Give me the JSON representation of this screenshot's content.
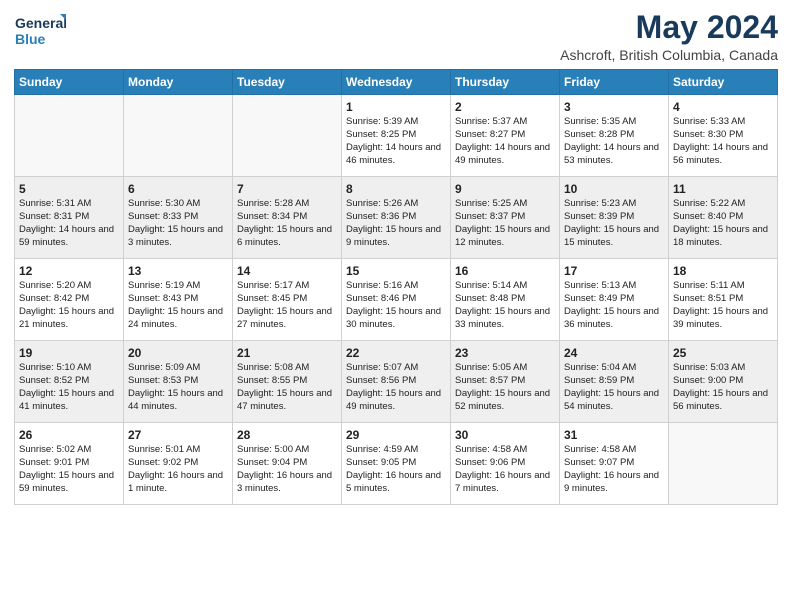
{
  "brand": {
    "name_line1": "General",
    "name_line2": "Blue"
  },
  "title": "May 2024",
  "location": "Ashcroft, British Columbia, Canada",
  "headers": [
    "Sunday",
    "Monday",
    "Tuesday",
    "Wednesday",
    "Thursday",
    "Friday",
    "Saturday"
  ],
  "weeks": [
    [
      {
        "day": "",
        "sunrise": "",
        "sunset": "",
        "daylight": ""
      },
      {
        "day": "",
        "sunrise": "",
        "sunset": "",
        "daylight": ""
      },
      {
        "day": "",
        "sunrise": "",
        "sunset": "",
        "daylight": ""
      },
      {
        "day": "1",
        "sunrise": "Sunrise: 5:39 AM",
        "sunset": "Sunset: 8:25 PM",
        "daylight": "Daylight: 14 hours and 46 minutes."
      },
      {
        "day": "2",
        "sunrise": "Sunrise: 5:37 AM",
        "sunset": "Sunset: 8:27 PM",
        "daylight": "Daylight: 14 hours and 49 minutes."
      },
      {
        "day": "3",
        "sunrise": "Sunrise: 5:35 AM",
        "sunset": "Sunset: 8:28 PM",
        "daylight": "Daylight: 14 hours and 53 minutes."
      },
      {
        "day": "4",
        "sunrise": "Sunrise: 5:33 AM",
        "sunset": "Sunset: 8:30 PM",
        "daylight": "Daylight: 14 hours and 56 minutes."
      }
    ],
    [
      {
        "day": "5",
        "sunrise": "Sunrise: 5:31 AM",
        "sunset": "Sunset: 8:31 PM",
        "daylight": "Daylight: 14 hours and 59 minutes."
      },
      {
        "day": "6",
        "sunrise": "Sunrise: 5:30 AM",
        "sunset": "Sunset: 8:33 PM",
        "daylight": "Daylight: 15 hours and 3 minutes."
      },
      {
        "day": "7",
        "sunrise": "Sunrise: 5:28 AM",
        "sunset": "Sunset: 8:34 PM",
        "daylight": "Daylight: 15 hours and 6 minutes."
      },
      {
        "day": "8",
        "sunrise": "Sunrise: 5:26 AM",
        "sunset": "Sunset: 8:36 PM",
        "daylight": "Daylight: 15 hours and 9 minutes."
      },
      {
        "day": "9",
        "sunrise": "Sunrise: 5:25 AM",
        "sunset": "Sunset: 8:37 PM",
        "daylight": "Daylight: 15 hours and 12 minutes."
      },
      {
        "day": "10",
        "sunrise": "Sunrise: 5:23 AM",
        "sunset": "Sunset: 8:39 PM",
        "daylight": "Daylight: 15 hours and 15 minutes."
      },
      {
        "day": "11",
        "sunrise": "Sunrise: 5:22 AM",
        "sunset": "Sunset: 8:40 PM",
        "daylight": "Daylight: 15 hours and 18 minutes."
      }
    ],
    [
      {
        "day": "12",
        "sunrise": "Sunrise: 5:20 AM",
        "sunset": "Sunset: 8:42 PM",
        "daylight": "Daylight: 15 hours and 21 minutes."
      },
      {
        "day": "13",
        "sunrise": "Sunrise: 5:19 AM",
        "sunset": "Sunset: 8:43 PM",
        "daylight": "Daylight: 15 hours and 24 minutes."
      },
      {
        "day": "14",
        "sunrise": "Sunrise: 5:17 AM",
        "sunset": "Sunset: 8:45 PM",
        "daylight": "Daylight: 15 hours and 27 minutes."
      },
      {
        "day": "15",
        "sunrise": "Sunrise: 5:16 AM",
        "sunset": "Sunset: 8:46 PM",
        "daylight": "Daylight: 15 hours and 30 minutes."
      },
      {
        "day": "16",
        "sunrise": "Sunrise: 5:14 AM",
        "sunset": "Sunset: 8:48 PM",
        "daylight": "Daylight: 15 hours and 33 minutes."
      },
      {
        "day": "17",
        "sunrise": "Sunrise: 5:13 AM",
        "sunset": "Sunset: 8:49 PM",
        "daylight": "Daylight: 15 hours and 36 minutes."
      },
      {
        "day": "18",
        "sunrise": "Sunrise: 5:11 AM",
        "sunset": "Sunset: 8:51 PM",
        "daylight": "Daylight: 15 hours and 39 minutes."
      }
    ],
    [
      {
        "day": "19",
        "sunrise": "Sunrise: 5:10 AM",
        "sunset": "Sunset: 8:52 PM",
        "daylight": "Daylight: 15 hours and 41 minutes."
      },
      {
        "day": "20",
        "sunrise": "Sunrise: 5:09 AM",
        "sunset": "Sunset: 8:53 PM",
        "daylight": "Daylight: 15 hours and 44 minutes."
      },
      {
        "day": "21",
        "sunrise": "Sunrise: 5:08 AM",
        "sunset": "Sunset: 8:55 PM",
        "daylight": "Daylight: 15 hours and 47 minutes."
      },
      {
        "day": "22",
        "sunrise": "Sunrise: 5:07 AM",
        "sunset": "Sunset: 8:56 PM",
        "daylight": "Daylight: 15 hours and 49 minutes."
      },
      {
        "day": "23",
        "sunrise": "Sunrise: 5:05 AM",
        "sunset": "Sunset: 8:57 PM",
        "daylight": "Daylight: 15 hours and 52 minutes."
      },
      {
        "day": "24",
        "sunrise": "Sunrise: 5:04 AM",
        "sunset": "Sunset: 8:59 PM",
        "daylight": "Daylight: 15 hours and 54 minutes."
      },
      {
        "day": "25",
        "sunrise": "Sunrise: 5:03 AM",
        "sunset": "Sunset: 9:00 PM",
        "daylight": "Daylight: 15 hours and 56 minutes."
      }
    ],
    [
      {
        "day": "26",
        "sunrise": "Sunrise: 5:02 AM",
        "sunset": "Sunset: 9:01 PM",
        "daylight": "Daylight: 15 hours and 59 minutes."
      },
      {
        "day": "27",
        "sunrise": "Sunrise: 5:01 AM",
        "sunset": "Sunset: 9:02 PM",
        "daylight": "Daylight: 16 hours and 1 minute."
      },
      {
        "day": "28",
        "sunrise": "Sunrise: 5:00 AM",
        "sunset": "Sunset: 9:04 PM",
        "daylight": "Daylight: 16 hours and 3 minutes."
      },
      {
        "day": "29",
        "sunrise": "Sunrise: 4:59 AM",
        "sunset": "Sunset: 9:05 PM",
        "daylight": "Daylight: 16 hours and 5 minutes."
      },
      {
        "day": "30",
        "sunrise": "Sunrise: 4:58 AM",
        "sunset": "Sunset: 9:06 PM",
        "daylight": "Daylight: 16 hours and 7 minutes."
      },
      {
        "day": "31",
        "sunrise": "Sunrise: 4:58 AM",
        "sunset": "Sunset: 9:07 PM",
        "daylight": "Daylight: 16 hours and 9 minutes."
      },
      {
        "day": "",
        "sunrise": "",
        "sunset": "",
        "daylight": ""
      }
    ]
  ]
}
